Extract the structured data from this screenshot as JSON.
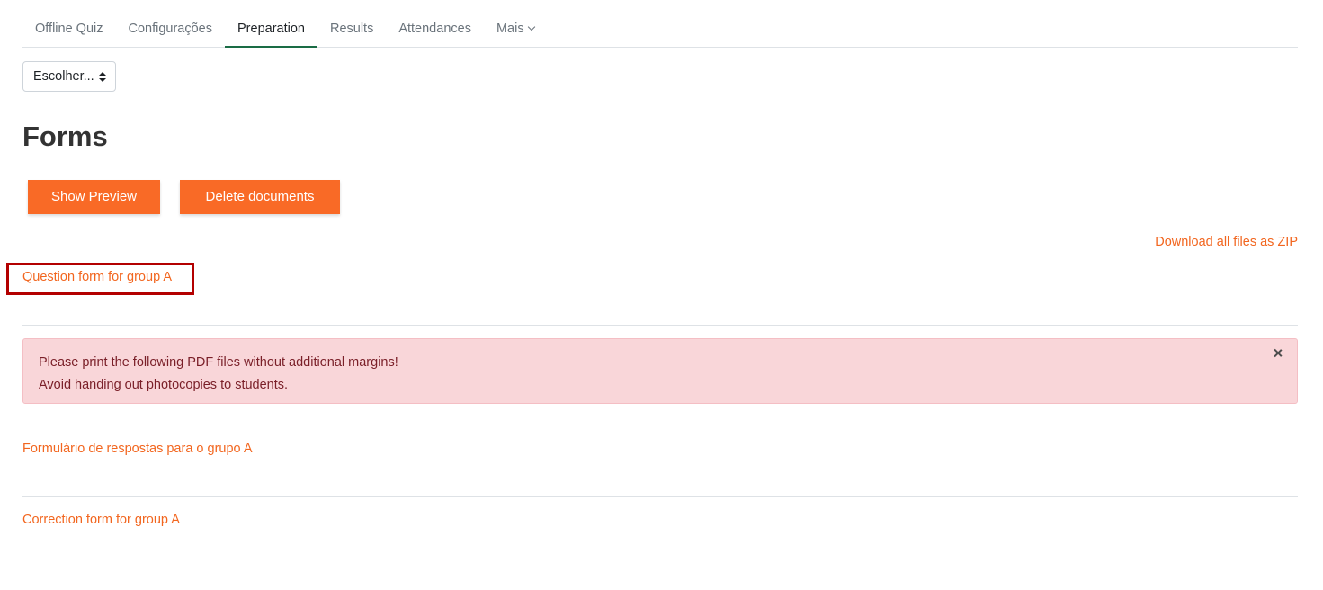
{
  "tabs": [
    {
      "label": "Offline Quiz",
      "active": false
    },
    {
      "label": "Configurações",
      "active": false
    },
    {
      "label": "Preparation",
      "active": true
    },
    {
      "label": "Results",
      "active": false
    },
    {
      "label": "Attendances",
      "active": false
    },
    {
      "label": "Mais",
      "active": false
    }
  ],
  "select": {
    "value": "Escolher..."
  },
  "page_title": "Forms",
  "buttons": {
    "show_preview": "Show Preview",
    "delete_documents": "Delete documents"
  },
  "download_zip": "Download all files as ZIP",
  "links": {
    "question_form": "Question form for group A",
    "answer_form": "Formulário de respostas para o grupo A",
    "correction_form": "Correction form for group A"
  },
  "alert": {
    "line1": "Please print the following PDF files without additional margins!",
    "line2": "Avoid handing out photocopies to students."
  },
  "colors": {
    "accent": "#f96a26",
    "link": "#f2661f",
    "active_tab": "#1a6c45",
    "alert_bg": "#f9d6d9",
    "highlight": "#b30000"
  }
}
